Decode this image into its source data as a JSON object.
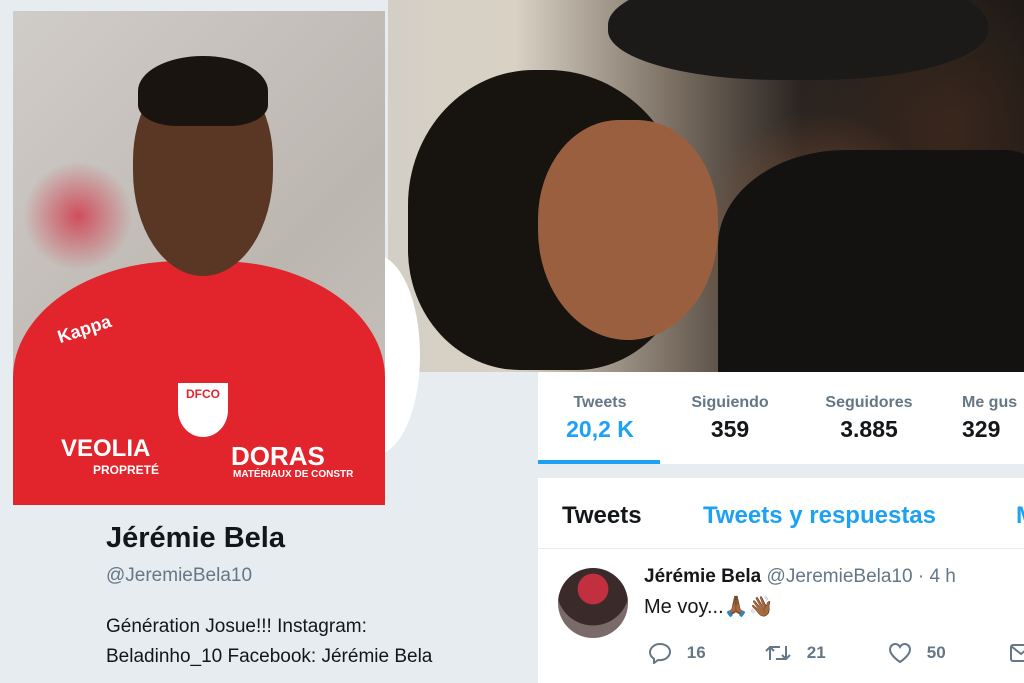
{
  "profile": {
    "name": "Jérémie Bela",
    "handle": "@JeremieBela10",
    "bio_line1": "Génération Josue!!! Instagram:",
    "bio_line2": "Beladinho_10 Facebook: Jérémie Bela",
    "jersey_brand": "Kappa",
    "sponsor1": "VEOLIA",
    "sponsor1_sub": "PROPRETÉ",
    "sponsor2": "DORAS",
    "sponsor2_sub": "MATÉRIAUX DE CONSTR",
    "club_badge": "DFCO"
  },
  "stats": [
    {
      "label": "Tweets",
      "value": "20,2 K"
    },
    {
      "label": "Siguiendo",
      "value": "359"
    },
    {
      "label": "Seguidores",
      "value": "3.885"
    },
    {
      "label": "Me gus",
      "value": "329"
    }
  ],
  "tabs": {
    "tweets": "Tweets",
    "tweets_replies": "Tweets y respuestas",
    "media": "M"
  },
  "tweet": {
    "name": "Jérémie Bela",
    "meta": "@JeremieBela10 · 4 h",
    "text": "Me voy...🙏🏾👋🏾",
    "replies": "16",
    "retweets": "21",
    "likes": "50"
  },
  "colors": {
    "accent": "#1da1f2",
    "text": "#14171a",
    "muted": "#657786",
    "jersey": "#e2242d"
  }
}
